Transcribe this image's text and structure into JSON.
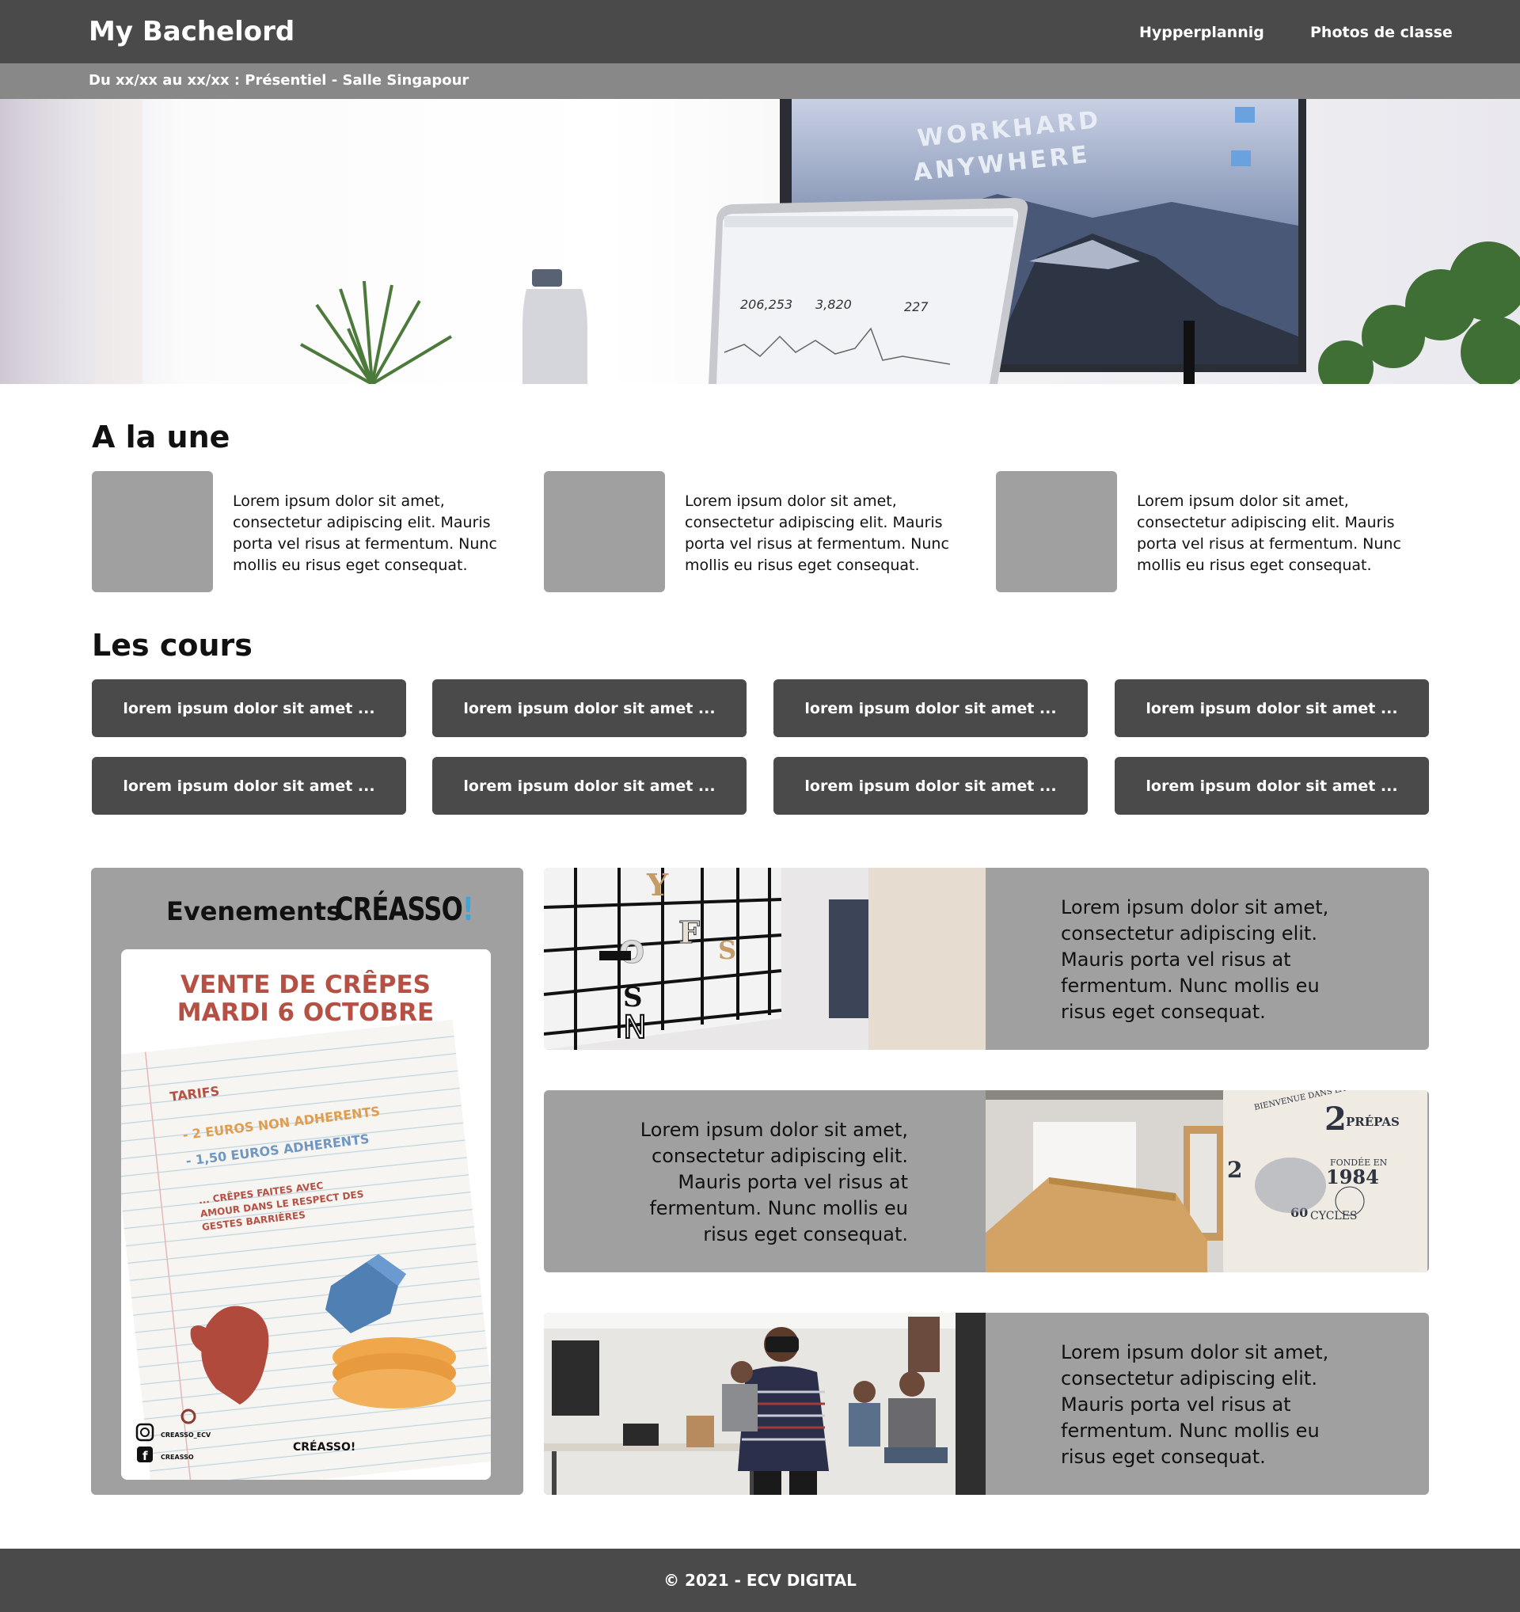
{
  "header": {
    "brand": "My Bachelord",
    "nav": [
      "Hypperplannig",
      "Photos de classe"
    ],
    "subtitle": "Du xx/xx au xx/xx : Présentiel - Salle Singapour"
  },
  "hero": {
    "monitor_text_line1": "WORKHARD",
    "monitor_text_line2": "ANYWHERE",
    "stat1": "206,253",
    "stat2": "3,820",
    "stat3": "227"
  },
  "news": {
    "title": "A la une",
    "items": [
      {
        "text": "Lorem ipsum dolor sit amet, consectetur adipiscing elit. Mauris porta vel risus at fermentum. Nunc mollis eu risus eget consequat."
      },
      {
        "text": "Lorem ipsum dolor sit amet, consectetur adipiscing elit. Mauris porta vel risus at fermentum. Nunc mollis eu risus eget consequat."
      },
      {
        "text": "Lorem ipsum dolor sit amet, consectetur adipiscing elit. Mauris porta vel risus at fermentum. Nunc mollis eu risus eget consequat."
      }
    ]
  },
  "courses": {
    "title": "Les cours",
    "items": [
      "lorem ipsum dolor sit amet ...",
      "lorem ipsum dolor sit amet ...",
      "lorem ipsum dolor sit amet ...",
      "lorem ipsum dolor sit amet ...",
      "lorem ipsum dolor sit amet ...",
      "lorem ipsum dolor sit amet ...",
      "lorem ipsum dolor sit amet ...",
      "lorem ipsum dolor sit amet ..."
    ]
  },
  "events": {
    "title": "Evenements",
    "logo_text": "CRÉASSO",
    "logo_bang": "!",
    "poster": {
      "headline1": "VENTE  DE CRÊPES",
      "headline2": "MARDI 6 OCTOBRE",
      "tarifs": "TARIFS",
      "price1": "- 2 EUROS NON ADHERENTS",
      "price2": "- 1,50 EUROS ADHERENTS",
      "note1": "... CRÊPES FAITES AVEC",
      "note2": "AMOUR DANS LE RESPECT DES",
      "note3": "GESTES BARRIÈRES",
      "instagram": "CREASSO_ECV",
      "facebook": "CREASSO",
      "signature": "CRÉASSO!"
    }
  },
  "features": [
    {
      "text": "Lorem ipsum dolor sit amet, consectetur adipiscing elit. Mauris porta vel risus at fermentum. Nunc mollis eu risus eget consequat."
    },
    {
      "text": "Lorem ipsum dolor sit amet, consectetur adipiscing elit. Mauris porta vel risus at fermentum. Nunc mollis eu risus eget consequat."
    },
    {
      "text": "Lorem ipsum dolor sit amet, consectetur adipiscing elit. Mauris porta vel risus at fermentum. Nunc mollis eu risus eget consequat."
    }
  ],
  "wall_text": {
    "line1": "BIENVENUE DANS LA",
    "line2": "PRÉPAS",
    "line3": "FONDÉE EN",
    "line4": "1984",
    "line5": "CYCLES",
    "line6": "60"
  },
  "footer": {
    "text": "© 2021 - ECV DIGITAL"
  }
}
